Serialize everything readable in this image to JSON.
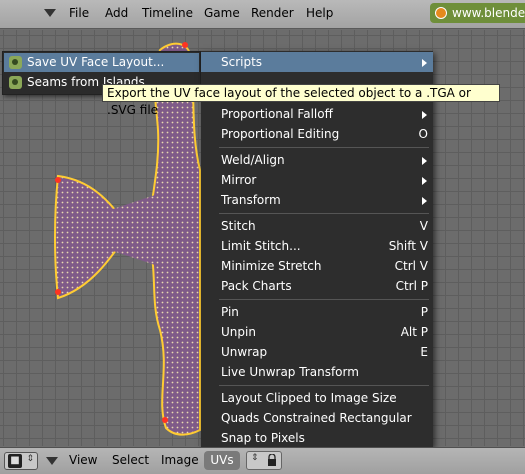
{
  "top_menu": {
    "items": [
      "File",
      "Add",
      "Timeline",
      "Game",
      "Render",
      "Help"
    ],
    "url_label": "www.blende"
  },
  "scripts_submenu": {
    "items": [
      "Save UV Face Layout...",
      "Seams from Islands"
    ],
    "highlighted_index": 0
  },
  "tooltip": "Export the UV face layout of the selected object to a .TGA or .SVG file",
  "uvs_menu": {
    "items": [
      {
        "label": "Scripts",
        "shortcut": "",
        "submenu": true
      },
      {
        "label": "Proportional Falloff",
        "shortcut": "",
        "submenu": true
      },
      {
        "label": "Proportional Editing",
        "shortcut": "O",
        "submenu": false
      },
      {
        "label": "Weld/Align",
        "shortcut": "",
        "submenu": true
      },
      {
        "label": "Mirror",
        "shortcut": "",
        "submenu": true
      },
      {
        "label": "Transform",
        "shortcut": "",
        "submenu": true
      },
      {
        "label": "Stitch",
        "shortcut": "V",
        "submenu": false
      },
      {
        "label": "Limit Stitch...",
        "shortcut": "Shift V",
        "submenu": false
      },
      {
        "label": "Minimize Stretch",
        "shortcut": "Ctrl V",
        "submenu": false
      },
      {
        "label": "Pack Charts",
        "shortcut": "Ctrl P",
        "submenu": false
      },
      {
        "label": "Pin",
        "shortcut": "P",
        "submenu": false
      },
      {
        "label": "Unpin",
        "shortcut": "Alt P",
        "submenu": false
      },
      {
        "label": "Unwrap",
        "shortcut": "E",
        "submenu": false
      },
      {
        "label": "Live Unwrap Transform",
        "shortcut": "",
        "submenu": false
      },
      {
        "label": "Layout Clipped to Image Size",
        "shortcut": "",
        "submenu": false
      },
      {
        "label": "Quads Constrained Rectangular",
        "shortcut": "",
        "submenu": false
      },
      {
        "label": "Snap to Pixels",
        "shortcut": "",
        "submenu": false
      }
    ],
    "highlighted_index": 0
  },
  "bottom_menu": {
    "items": [
      "View",
      "Select",
      "Image"
    ],
    "active_menu": "UVs"
  },
  "colors": {
    "menu_bg": "#2d2d2d",
    "highlight": "#5b7c9c",
    "uv_mesh": "#7f5a88",
    "tooltip_bg": "#ffffcf"
  }
}
